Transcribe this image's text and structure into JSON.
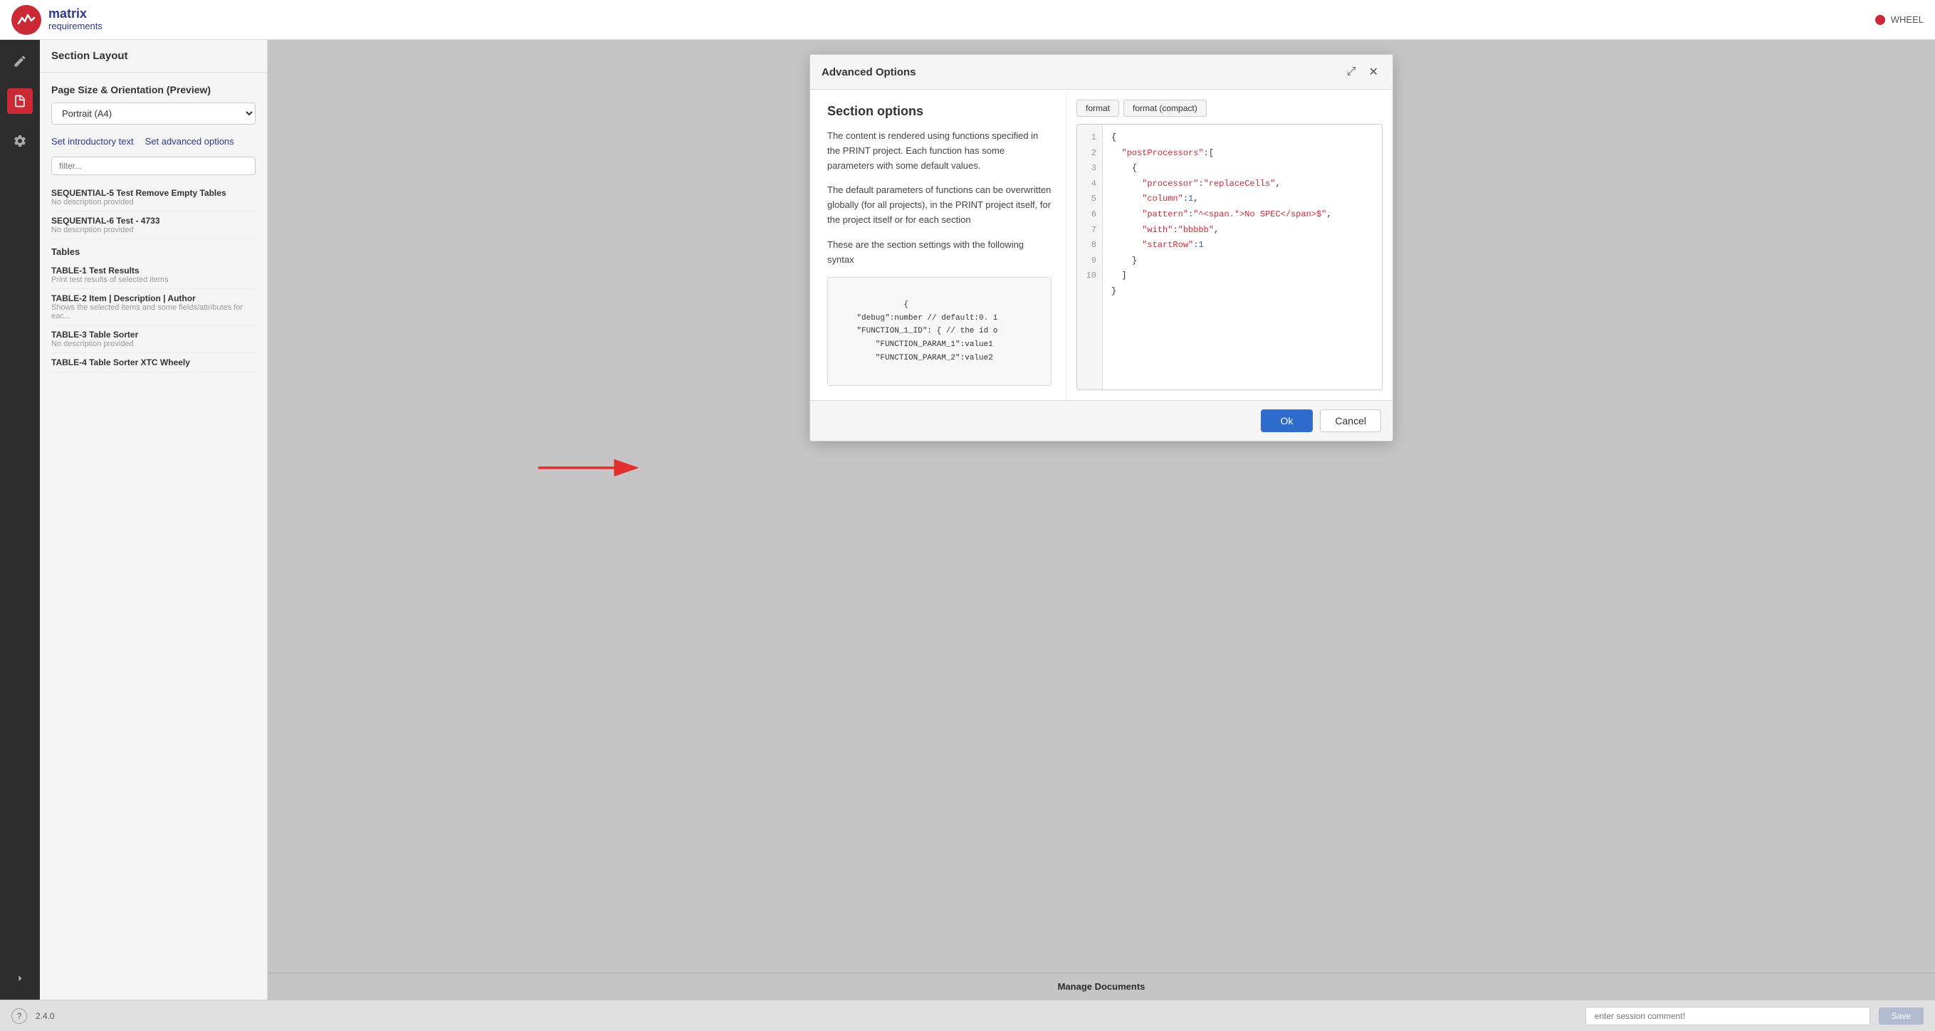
{
  "topBar": {
    "brandName": "matrix",
    "brandSub": "requirements",
    "rightLabel": "WHEEL"
  },
  "sectionLayout": {
    "panelTitle": "Section Layout",
    "pageSizeTitle": "Page Size & Orientation (Preview)",
    "pageSizeValue": "Portrait (A4)",
    "linkIntroText": "Set introductory text",
    "linkAdvancedText": "Set advanced options",
    "filterPlaceholder": "filter...",
    "sections": [
      {
        "id": "SEQUENTIAL-5",
        "title": "Test Remove Empty Tables",
        "desc": "No description provided"
      },
      {
        "id": "SEQUENTIAL-6",
        "title": "Test - 4733",
        "desc": "No description provided"
      }
    ],
    "tablesTitle": "Tables",
    "tables": [
      {
        "id": "TABLE-1",
        "title": "Test Results",
        "desc": "Print test results of selected items"
      },
      {
        "id": "TABLE-2",
        "title": "Item | Description | Author",
        "desc": "Shows the selected items and some fields/attributes for eac..."
      },
      {
        "id": "TABLE-3",
        "title": "Table Sorter",
        "desc": "No description provided"
      },
      {
        "id": "TABLE-4",
        "title": "Table Sorter XTC Wheely",
        "desc": ""
      }
    ]
  },
  "advancedOptions": {
    "title": "Advanced Options",
    "sectionOptionsTitle": "Section options",
    "para1": "The content is rendered using functions specified in the PRINT project. Each function has some parameters with some default values.",
    "para2": "The default parameters of functions can be overwritten globally (for all projects), in the PRINT project itself, for the project itself or for each section",
    "para3": "These are the section settings with the following syntax",
    "codeSnippet": "{\n    \"debug\":number // default:0. i\n    \"FUNCTION_1_ID\": { // the id o\n        \"FUNCTION_PARAM_1\":value1\n        \"FUNCTION_PARAM_2\":value2",
    "formatBtn": "format",
    "formatCompactBtn": "format (compact)",
    "editorLines": [
      {
        "num": 1,
        "content": "{"
      },
      {
        "num": 2,
        "content": "  \"postProcessors\":["
      },
      {
        "num": 3,
        "content": "    {"
      },
      {
        "num": 4,
        "content": "      \"processor\":\"replaceCells\","
      },
      {
        "num": 5,
        "content": "      \"column\":1,"
      },
      {
        "num": 6,
        "content": "      \"pattern\":\"^<span.*>No SPEC</span>$\","
      },
      {
        "num": 7,
        "content": "      \"with\":\"bbbbb\","
      },
      {
        "num": 8,
        "content": "      \"startRow\":1"
      },
      {
        "num": 9,
        "content": "    }"
      },
      {
        "num": 10,
        "content": "  ]"
      }
    ],
    "editorClosing": "}",
    "okLabel": "Ok",
    "cancelLabel": "Cancel"
  },
  "manageDocuments": {
    "label": "Manage Documents"
  },
  "bottomBar": {
    "version": "2.4.0",
    "sessionPlaceholder": "enter session comment!",
    "saveLabel": "Save"
  }
}
